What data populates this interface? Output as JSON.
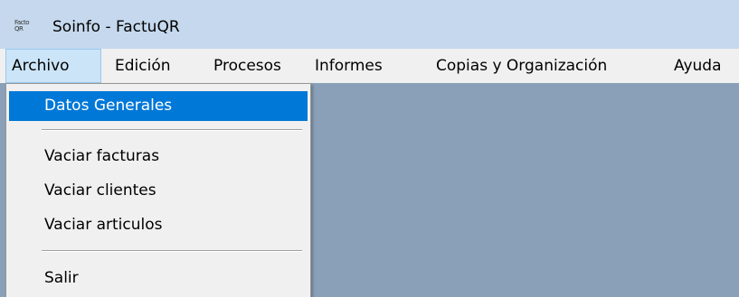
{
  "window": {
    "title": "Soinfo - FactuQR",
    "icon_name": "factuqr-app-icon",
    "icon_text_top": "Facto",
    "icon_text_bottom": "QR"
  },
  "menubar": {
    "items": [
      {
        "label": "Archivo"
      },
      {
        "label": "Edición"
      },
      {
        "label": "Procesos"
      },
      {
        "label": "Informes"
      },
      {
        "label": "Copias y Organización"
      },
      {
        "label": "Ayuda"
      }
    ]
  },
  "archivo_menu": {
    "items": [
      {
        "label": "Datos Generales"
      },
      {
        "label": "Vaciar facturas"
      },
      {
        "label": "Vaciar clientes"
      },
      {
        "label": "Vaciar articulos"
      },
      {
        "label": "Salir"
      }
    ]
  },
  "colors": {
    "titlebar": "#c5d8ed",
    "workspace": "#8aa0b8",
    "highlight": "#0078d7"
  }
}
